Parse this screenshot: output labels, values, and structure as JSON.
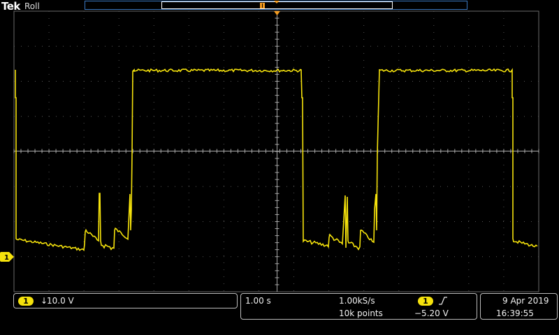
{
  "header": {
    "brand": "Tek",
    "acq_mode": "Roll"
  },
  "channel": {
    "number": "1",
    "scale": "10.0 V",
    "coupling_icon": "down-arrow-icon",
    "color": "#f5e20c"
  },
  "timebase": {
    "scale": "1.00 s",
    "sample_rate": "1.00kS/s",
    "record_length": "10k points"
  },
  "trigger": {
    "source": "1",
    "slope_icon": "rising-edge-icon",
    "level": "−5.20 V"
  },
  "clock": {
    "date": "9 Apr  2019",
    "time": "16:39:55"
  },
  "waveform": {
    "description_points_x_div": [
      0,
      0.02,
      0.03,
      0.05,
      0.06,
      0.5,
      0.8,
      0.9,
      1.0,
      1.05,
      1.15,
      1.2,
      1.3,
      1.6,
      1.62,
      1.63,
      4.05,
      4.07,
      4.08,
      4.2,
      4.3,
      4.5,
      4.6,
      4.8,
      5.0,
      5.2,
      5.3,
      5.7,
      5.72,
      5.73,
      8.15,
      8.17,
      8.18,
      8.3,
      8.5,
      8.6,
      8.8,
      9.0,
      9.2,
      9.4,
      9.7,
      9.9,
      10.0
    ]
  }
}
